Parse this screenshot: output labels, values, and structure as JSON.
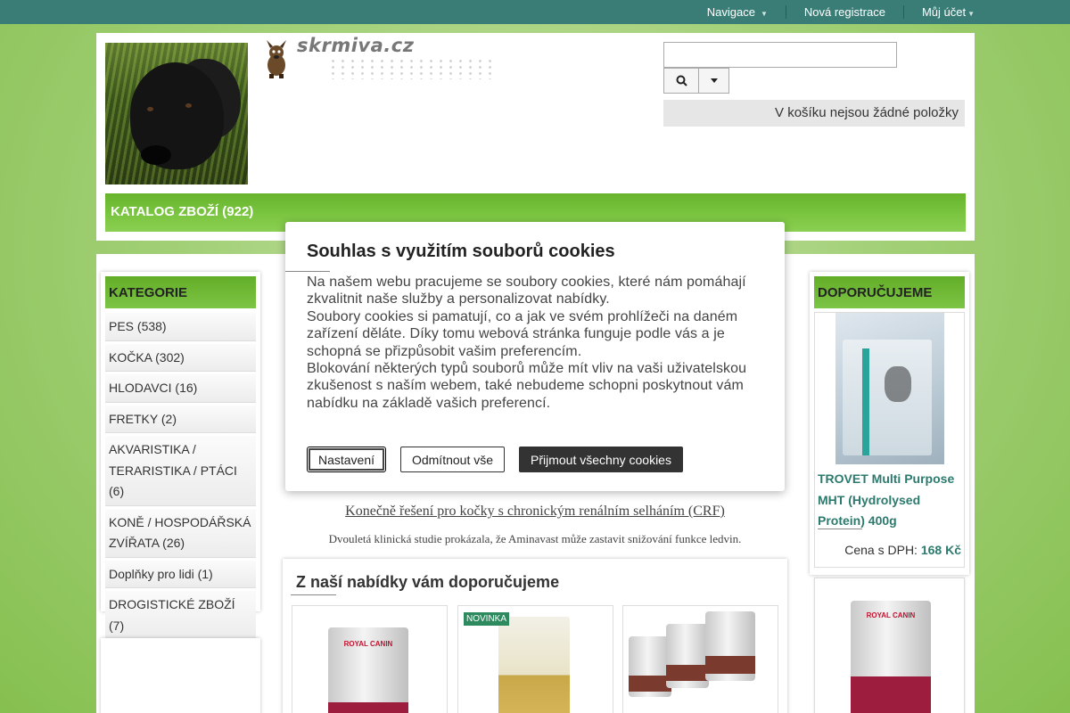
{
  "topnav": {
    "items": [
      "Navigace",
      "Nová registrace",
      "Můj účet"
    ]
  },
  "header": {
    "logo_text": "skrmiva.cz",
    "search_placeholder": "",
    "cart_text": "V košíku nejsou žádné položky",
    "catalog_label": "KATALOG ZBOŽÍ (922)"
  },
  "sidebar": {
    "title": "KATEGORIE",
    "items": [
      "PES (538)",
      "KOČKA (302)",
      "HLODAVCI (16)",
      "FRETKY (2)",
      "AKVARISTIKA / TERARISTIKA / PTÁCI (6)",
      "KONĚ / HOSPODÁŘSKÁ ZVÍŘATA (26)",
      "Doplňky pro lidi (1)",
      "DROGISTICKÉ ZBOŽÍ (7)"
    ]
  },
  "promo": {
    "link": "Konečně řešení pro kočky   s chronickým renálním selháním (CRF)",
    "text": "Dvouletá klinická studie prokázala,   že Aminavast může zastavit snižování funkce ledvin."
  },
  "offers": {
    "title": "Z naší nabídky vám doporučujeme",
    "badge": "NOVINKA"
  },
  "recommend": {
    "title": "DOPORUČUJEME",
    "product_name": "TROVET Multi Purpose MHT (Hydrolysed Protein) 400g",
    "price_label": "Cena s DPH:",
    "price_value": "168 Kč"
  },
  "cookie_modal": {
    "title": "Souhlas s využitím souborů cookies",
    "paragraphs": [
      "Na našem webu pracujeme se soubory cookies, které nám pomáhají zkvalitnit naše služby a personalizovat nabídky.",
      "Soubory cookies si pamatují, co a jak ve svém prohlížeči na daném zařízení děláte. Díky tomu webová stránka funguje podle vás a je schopná se přizpůsobit vašim preferencím.",
      "Blokování některých typů souborů může mít vliv na vaši uživatelskou zkušenost s naším webem, také nebudeme schopni poskytnout vám nabídku na základě vašich preferencí."
    ],
    "btn_settings": "Nastavení",
    "btn_reject": "Odmítnout vše",
    "btn_accept": "Přijmout všechny cookies"
  },
  "colors": {
    "topbar": "#3a7d77",
    "accent_green": "#6cb733",
    "product_link": "#2c7a6e",
    "accept_button": "#333333"
  },
  "icons": [
    "search-icon",
    "caret-down-icon"
  ]
}
